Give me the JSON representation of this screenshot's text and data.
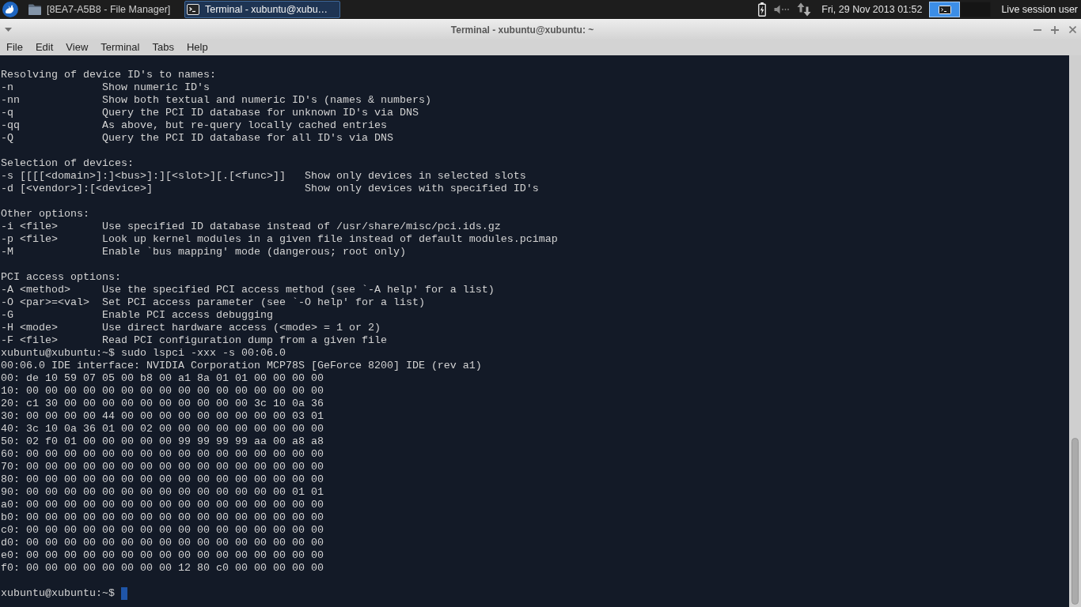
{
  "panel": {
    "tasks": [
      {
        "kind": "file_manager",
        "label": "[8EA7-A5B8 - File Manager]",
        "selected": false
      },
      {
        "kind": "terminal",
        "label": "Terminal - xubuntu@xubu…",
        "selected": true
      }
    ],
    "clock": "Fri, 29 Nov 2013 01:52",
    "workspaces": [
      {
        "selected": true,
        "has_window": true
      },
      {
        "selected": false,
        "has_window": false
      }
    ],
    "user": "Live session user"
  },
  "window": {
    "title": "Terminal - xubuntu@xubuntu: ~"
  },
  "menu": [
    "File",
    "Edit",
    "View",
    "Terminal",
    "Tabs",
    "Help"
  ],
  "terminal": {
    "blocks": [
      [
        "Resolving of device ID's to names:",
        "-n              Show numeric ID's",
        "-nn             Show both textual and numeric ID's (names & numbers)",
        "-q              Query the PCI ID database for unknown ID's via DNS",
        "-qq             As above, but re-query locally cached entries",
        "-Q              Query the PCI ID database for all ID's via DNS"
      ],
      [
        "Selection of devices:",
        "-s [[[[<domain>]:]<bus>]:][<slot>][.[<func>]]   Show only devices in selected slots",
        "-d [<vendor>]:[<device>]                        Show only devices with specified ID's"
      ],
      [
        "Other options:",
        "-i <file>       Use specified ID database instead of /usr/share/misc/pci.ids.gz",
        "-p <file>       Look up kernel modules in a given file instead of default modules.pcimap",
        "-M              Enable `bus mapping' mode (dangerous; root only)"
      ],
      [
        "PCI access options:",
        "-A <method>     Use the specified PCI access method (see `-A help' for a list)",
        "-O <par>=<val>  Set PCI access parameter (see `-O help' for a list)",
        "-G              Enable PCI access debugging",
        "-H <mode>       Use direct hardware access (<mode> = 1 or 2)",
        "-F <file>       Read PCI configuration dump from a given file",
        "xubuntu@xubuntu:~$ sudo lspci -xxx -s 00:06.0",
        "00:06.0 IDE interface: NVIDIA Corporation MCP78S [GeForce 8200] IDE (rev a1)",
        "00: de 10 59 07 05 00 b8 00 a1 8a 01 01 00 00 00 00",
        "10: 00 00 00 00 00 00 00 00 00 00 00 00 00 00 00 00",
        "20: c1 30 00 00 00 00 00 00 00 00 00 00 3c 10 0a 36",
        "30: 00 00 00 00 44 00 00 00 00 00 00 00 00 00 03 01",
        "40: 3c 10 0a 36 01 00 02 00 00 00 00 00 00 00 00 00",
        "50: 02 f0 01 00 00 00 00 00 99 99 99 99 aa 00 a8 a8",
        "60: 00 00 00 00 00 00 00 00 00 00 00 00 00 00 00 00",
        "70: 00 00 00 00 00 00 00 00 00 00 00 00 00 00 00 00",
        "80: 00 00 00 00 00 00 00 00 00 00 00 00 00 00 00 00",
        "90: 00 00 00 00 00 00 00 00 00 00 00 00 00 00 01 01",
        "a0: 00 00 00 00 00 00 00 00 00 00 00 00 00 00 00 00",
        "b0: 00 00 00 00 00 00 00 00 00 00 00 00 00 00 00 00",
        "c0: 00 00 00 00 00 00 00 00 00 00 00 00 00 00 00 00",
        "d0: 00 00 00 00 00 00 00 00 00 00 00 00 00 00 00 00",
        "e0: 00 00 00 00 00 00 00 00 00 00 00 00 00 00 00 00",
        "f0: 00 00 00 00 00 00 00 00 12 80 c0 00 00 00 00 00"
      ]
    ],
    "prompt": "xubuntu@xubuntu:~$"
  }
}
